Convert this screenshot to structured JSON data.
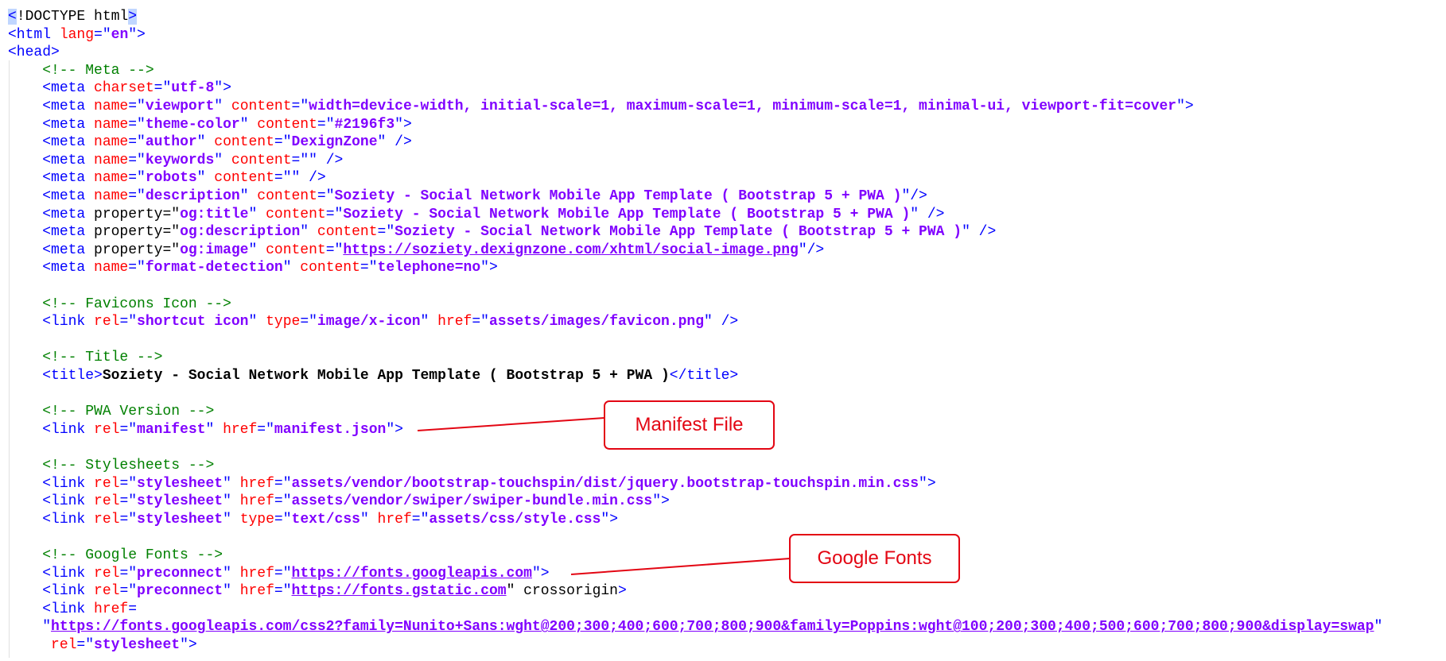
{
  "colors": {
    "text": "#000000",
    "tag": "#0000ff",
    "attribute": "#ff0000",
    "value": "#8000ff",
    "comment": "#008000",
    "selection": "#c0d6ff",
    "callout": "#e30613"
  },
  "code": {
    "lines": [
      {
        "tokens": [
          {
            "t": "<",
            "c": "tag",
            "sel": true
          },
          {
            "t": "!DOCTYPE html",
            "c": "text"
          },
          {
            "t": ">",
            "c": "tag",
            "sel": true
          }
        ]
      },
      {
        "tokens": [
          {
            "t": "<html ",
            "c": "tag"
          },
          {
            "t": "lang",
            "c": "attr"
          },
          {
            "t": "=\"",
            "c": "tag"
          },
          {
            "t": "en",
            "c": "val"
          },
          {
            "t": "\">",
            "c": "tag"
          }
        ]
      },
      {
        "tokens": [
          {
            "t": "<head>",
            "c": "tag"
          }
        ]
      },
      {
        "tokens": [
          {
            "t": "    <!-- Meta -->",
            "c": "comment"
          }
        ]
      },
      {
        "tokens": [
          {
            "t": "    ",
            "c": "text"
          },
          {
            "t": "<meta ",
            "c": "tag"
          },
          {
            "t": "charset",
            "c": "attr"
          },
          {
            "t": "=\"",
            "c": "tag"
          },
          {
            "t": "utf-8",
            "c": "val"
          },
          {
            "t": "\">",
            "c": "tag"
          }
        ]
      },
      {
        "tokens": [
          {
            "t": "    ",
            "c": "text"
          },
          {
            "t": "<meta ",
            "c": "tag"
          },
          {
            "t": "name",
            "c": "attr"
          },
          {
            "t": "=\"",
            "c": "tag"
          },
          {
            "t": "viewport",
            "c": "val"
          },
          {
            "t": "\" ",
            "c": "tag"
          },
          {
            "t": "content",
            "c": "attr"
          },
          {
            "t": "=\"",
            "c": "tag"
          },
          {
            "t": "width=device-width, initial-scale=1, maximum-scale=1, minimum-scale=1, minimal-ui, viewport-fit=cover",
            "c": "val"
          },
          {
            "t": "\">",
            "c": "tag"
          }
        ]
      },
      {
        "tokens": [
          {
            "t": "    ",
            "c": "text"
          },
          {
            "t": "<meta ",
            "c": "tag"
          },
          {
            "t": "name",
            "c": "attr"
          },
          {
            "t": "=\"",
            "c": "tag"
          },
          {
            "t": "theme-color",
            "c": "val"
          },
          {
            "t": "\" ",
            "c": "tag"
          },
          {
            "t": "content",
            "c": "attr"
          },
          {
            "t": "=\"",
            "c": "tag"
          },
          {
            "t": "#2196f3",
            "c": "val"
          },
          {
            "t": "\">",
            "c": "tag"
          }
        ]
      },
      {
        "tokens": [
          {
            "t": "    ",
            "c": "text"
          },
          {
            "t": "<meta ",
            "c": "tag"
          },
          {
            "t": "name",
            "c": "attr"
          },
          {
            "t": "=\"",
            "c": "tag"
          },
          {
            "t": "author",
            "c": "val"
          },
          {
            "t": "\" ",
            "c": "tag"
          },
          {
            "t": "content",
            "c": "attr"
          },
          {
            "t": "=\"",
            "c": "tag"
          },
          {
            "t": "DexignZone",
            "c": "val"
          },
          {
            "t": "\" />",
            "c": "tag"
          }
        ]
      },
      {
        "tokens": [
          {
            "t": "    ",
            "c": "text"
          },
          {
            "t": "<meta ",
            "c": "tag"
          },
          {
            "t": "name",
            "c": "attr"
          },
          {
            "t": "=\"",
            "c": "tag"
          },
          {
            "t": "keywords",
            "c": "val"
          },
          {
            "t": "\" ",
            "c": "tag"
          },
          {
            "t": "content",
            "c": "attr"
          },
          {
            "t": "=\"\" />",
            "c": "tag"
          }
        ]
      },
      {
        "tokens": [
          {
            "t": "    ",
            "c": "text"
          },
          {
            "t": "<meta ",
            "c": "tag"
          },
          {
            "t": "name",
            "c": "attr"
          },
          {
            "t": "=\"",
            "c": "tag"
          },
          {
            "t": "robots",
            "c": "val"
          },
          {
            "t": "\" ",
            "c": "tag"
          },
          {
            "t": "content",
            "c": "attr"
          },
          {
            "t": "=\"\" />",
            "c": "tag"
          }
        ]
      },
      {
        "tokens": [
          {
            "t": "    ",
            "c": "text"
          },
          {
            "t": "<meta ",
            "c": "tag"
          },
          {
            "t": "name",
            "c": "attr"
          },
          {
            "t": "=\"",
            "c": "tag"
          },
          {
            "t": "description",
            "c": "val"
          },
          {
            "t": "\" ",
            "c": "tag"
          },
          {
            "t": "content",
            "c": "attr"
          },
          {
            "t": "=\"",
            "c": "tag"
          },
          {
            "t": "Soziety - Social Network Mobile App Template ( Bootstrap 5 + PWA )",
            "c": "val"
          },
          {
            "t": "\"/>",
            "c": "tag"
          }
        ]
      },
      {
        "tokens": [
          {
            "t": "    ",
            "c": "text"
          },
          {
            "t": "<meta ",
            "c": "tag"
          },
          {
            "t": "property=\"",
            "c": "text"
          },
          {
            "t": "og:title",
            "c": "val"
          },
          {
            "t": "\" ",
            "c": "tag"
          },
          {
            "t": "content",
            "c": "attr"
          },
          {
            "t": "=\"",
            "c": "tag"
          },
          {
            "t": "Soziety - Social Network Mobile App Template ( Bootstrap 5 + PWA )",
            "c": "val"
          },
          {
            "t": "\" />",
            "c": "tag"
          }
        ]
      },
      {
        "tokens": [
          {
            "t": "    ",
            "c": "text"
          },
          {
            "t": "<meta ",
            "c": "tag"
          },
          {
            "t": "property=\"",
            "c": "text"
          },
          {
            "t": "og:description",
            "c": "val"
          },
          {
            "t": "\" ",
            "c": "tag"
          },
          {
            "t": "content",
            "c": "attr"
          },
          {
            "t": "=\"",
            "c": "tag"
          },
          {
            "t": "Soziety - Social Network Mobile App Template ( Bootstrap 5 + PWA )",
            "c": "val"
          },
          {
            "t": "\" />",
            "c": "tag"
          }
        ]
      },
      {
        "tokens": [
          {
            "t": "    ",
            "c": "text"
          },
          {
            "t": "<meta ",
            "c": "tag"
          },
          {
            "t": "property=\"",
            "c": "text"
          },
          {
            "t": "og:image",
            "c": "val"
          },
          {
            "t": "\" ",
            "c": "tag"
          },
          {
            "t": "content",
            "c": "attr"
          },
          {
            "t": "=\"",
            "c": "tag"
          },
          {
            "t": "https://soziety.dexignzone.com/xhtml/social-image.png",
            "c": "url"
          },
          {
            "t": "\"/>",
            "c": "tag"
          }
        ]
      },
      {
        "tokens": [
          {
            "t": "    ",
            "c": "text"
          },
          {
            "t": "<meta ",
            "c": "tag"
          },
          {
            "t": "name",
            "c": "attr"
          },
          {
            "t": "=\"",
            "c": "tag"
          },
          {
            "t": "format-detection",
            "c": "val"
          },
          {
            "t": "\" ",
            "c": "tag"
          },
          {
            "t": "content",
            "c": "attr"
          },
          {
            "t": "=\"",
            "c": "tag"
          },
          {
            "t": "telephone=no",
            "c": "val"
          },
          {
            "t": "\">",
            "c": "tag"
          }
        ]
      },
      {
        "tokens": []
      },
      {
        "tokens": [
          {
            "t": "    <!-- Favicons Icon -->",
            "c": "comment"
          }
        ]
      },
      {
        "tokens": [
          {
            "t": "    ",
            "c": "text"
          },
          {
            "t": "<link ",
            "c": "tag"
          },
          {
            "t": "rel",
            "c": "attr"
          },
          {
            "t": "=\"",
            "c": "tag"
          },
          {
            "t": "shortcut icon",
            "c": "val"
          },
          {
            "t": "\" ",
            "c": "tag"
          },
          {
            "t": "type",
            "c": "attr"
          },
          {
            "t": "=\"",
            "c": "tag"
          },
          {
            "t": "image/x-icon",
            "c": "val"
          },
          {
            "t": "\" ",
            "c": "tag"
          },
          {
            "t": "href",
            "c": "attr"
          },
          {
            "t": "=\"",
            "c": "tag"
          },
          {
            "t": "assets/images/favicon.png",
            "c": "val"
          },
          {
            "t": "\" />",
            "c": "tag"
          }
        ]
      },
      {
        "tokens": []
      },
      {
        "tokens": [
          {
            "t": "    <!-- Title -->",
            "c": "comment"
          }
        ]
      },
      {
        "tokens": [
          {
            "t": "    ",
            "c": "text"
          },
          {
            "t": "<title>",
            "c": "tag"
          },
          {
            "t": "Soziety - Social Network Mobile App Template ( Bootstrap 5 + PWA )",
            "c": "bold"
          },
          {
            "t": "</title>",
            "c": "tag"
          }
        ]
      },
      {
        "tokens": []
      },
      {
        "tokens": [
          {
            "t": "    <!-- PWA Version -->",
            "c": "comment"
          }
        ]
      },
      {
        "tokens": [
          {
            "t": "    ",
            "c": "text"
          },
          {
            "t": "<link ",
            "c": "tag"
          },
          {
            "t": "rel",
            "c": "attr"
          },
          {
            "t": "=\"",
            "c": "tag"
          },
          {
            "t": "manifest",
            "c": "val"
          },
          {
            "t": "\" ",
            "c": "tag"
          },
          {
            "t": "href",
            "c": "attr"
          },
          {
            "t": "=\"",
            "c": "tag"
          },
          {
            "t": "manifest.json",
            "c": "val"
          },
          {
            "t": "\">",
            "c": "tag"
          }
        ]
      },
      {
        "tokens": []
      },
      {
        "tokens": [
          {
            "t": "    <!-- Stylesheets -->",
            "c": "comment"
          }
        ]
      },
      {
        "tokens": [
          {
            "t": "    ",
            "c": "text"
          },
          {
            "t": "<link ",
            "c": "tag"
          },
          {
            "t": "rel",
            "c": "attr"
          },
          {
            "t": "=\"",
            "c": "tag"
          },
          {
            "t": "stylesheet",
            "c": "val"
          },
          {
            "t": "\" ",
            "c": "tag"
          },
          {
            "t": "href",
            "c": "attr"
          },
          {
            "t": "=\"",
            "c": "tag"
          },
          {
            "t": "assets/vendor/bootstrap-touchspin/dist/jquery.bootstrap-touchspin.min.css",
            "c": "val"
          },
          {
            "t": "\">",
            "c": "tag"
          }
        ]
      },
      {
        "tokens": [
          {
            "t": "    ",
            "c": "text"
          },
          {
            "t": "<link ",
            "c": "tag"
          },
          {
            "t": "rel",
            "c": "attr"
          },
          {
            "t": "=\"",
            "c": "tag"
          },
          {
            "t": "stylesheet",
            "c": "val"
          },
          {
            "t": "\" ",
            "c": "tag"
          },
          {
            "t": "href",
            "c": "attr"
          },
          {
            "t": "=\"",
            "c": "tag"
          },
          {
            "t": "assets/vendor/swiper/swiper-bundle.min.css",
            "c": "val"
          },
          {
            "t": "\">",
            "c": "tag"
          }
        ]
      },
      {
        "tokens": [
          {
            "t": "    ",
            "c": "text"
          },
          {
            "t": "<link ",
            "c": "tag"
          },
          {
            "t": "rel",
            "c": "attr"
          },
          {
            "t": "=\"",
            "c": "tag"
          },
          {
            "t": "stylesheet",
            "c": "val"
          },
          {
            "t": "\" ",
            "c": "tag"
          },
          {
            "t": "type",
            "c": "attr"
          },
          {
            "t": "=\"",
            "c": "tag"
          },
          {
            "t": "text/css",
            "c": "val"
          },
          {
            "t": "\" ",
            "c": "tag"
          },
          {
            "t": "href",
            "c": "attr"
          },
          {
            "t": "=\"",
            "c": "tag"
          },
          {
            "t": "assets/css/style.css",
            "c": "val"
          },
          {
            "t": "\">",
            "c": "tag"
          }
        ]
      },
      {
        "tokens": []
      },
      {
        "tokens": [
          {
            "t": "    <!-- Google Fonts -->",
            "c": "comment"
          }
        ]
      },
      {
        "tokens": [
          {
            "t": "    ",
            "c": "text"
          },
          {
            "t": "<link ",
            "c": "tag"
          },
          {
            "t": "rel",
            "c": "attr"
          },
          {
            "t": "=\"",
            "c": "tag"
          },
          {
            "t": "preconnect",
            "c": "val"
          },
          {
            "t": "\" ",
            "c": "tag"
          },
          {
            "t": "href",
            "c": "attr"
          },
          {
            "t": "=\"",
            "c": "tag"
          },
          {
            "t": "https://fonts.googleapis.com",
            "c": "url"
          },
          {
            "t": "\">",
            "c": "tag"
          }
        ]
      },
      {
        "tokens": [
          {
            "t": "    ",
            "c": "text"
          },
          {
            "t": "<link ",
            "c": "tag"
          },
          {
            "t": "rel",
            "c": "attr"
          },
          {
            "t": "=\"",
            "c": "tag"
          },
          {
            "t": "preconnect",
            "c": "val"
          },
          {
            "t": "\" ",
            "c": "tag"
          },
          {
            "t": "href",
            "c": "attr"
          },
          {
            "t": "=\"",
            "c": "tag"
          },
          {
            "t": "https://fonts.gstatic.com",
            "c": "url"
          },
          {
            "t": "\" crossorigin",
            "c": "text"
          },
          {
            "t": ">",
            "c": "tag"
          }
        ]
      },
      {
        "tokens": [
          {
            "t": "    ",
            "c": "text"
          },
          {
            "t": "<link ",
            "c": "tag"
          },
          {
            "t": "href",
            "c": "attr"
          },
          {
            "t": "=",
            "c": "tag"
          }
        ]
      },
      {
        "tokens": [
          {
            "t": "    \"",
            "c": "tag"
          },
          {
            "t": "https://fonts.googleapis.com/css2?family=Nunito+Sans:wght@200;300;400;600;700;800;900&family=Poppins:wght@100;200;300;400;500;600;700;800;900&display=swap",
            "c": "url"
          },
          {
            "t": "\"",
            "c": "tag"
          }
        ]
      },
      {
        "tokens": [
          {
            "t": "     ",
            "c": "text"
          },
          {
            "t": "rel",
            "c": "attr"
          },
          {
            "t": "=\"",
            "c": "tag"
          },
          {
            "t": "stylesheet",
            "c": "val"
          },
          {
            "t": "\">",
            "c": "tag"
          }
        ]
      }
    ]
  },
  "callouts": [
    {
      "name": "manifest-file-callout",
      "label": "Manifest File"
    },
    {
      "name": "google-fonts-callout",
      "label": "Google Fonts"
    }
  ]
}
